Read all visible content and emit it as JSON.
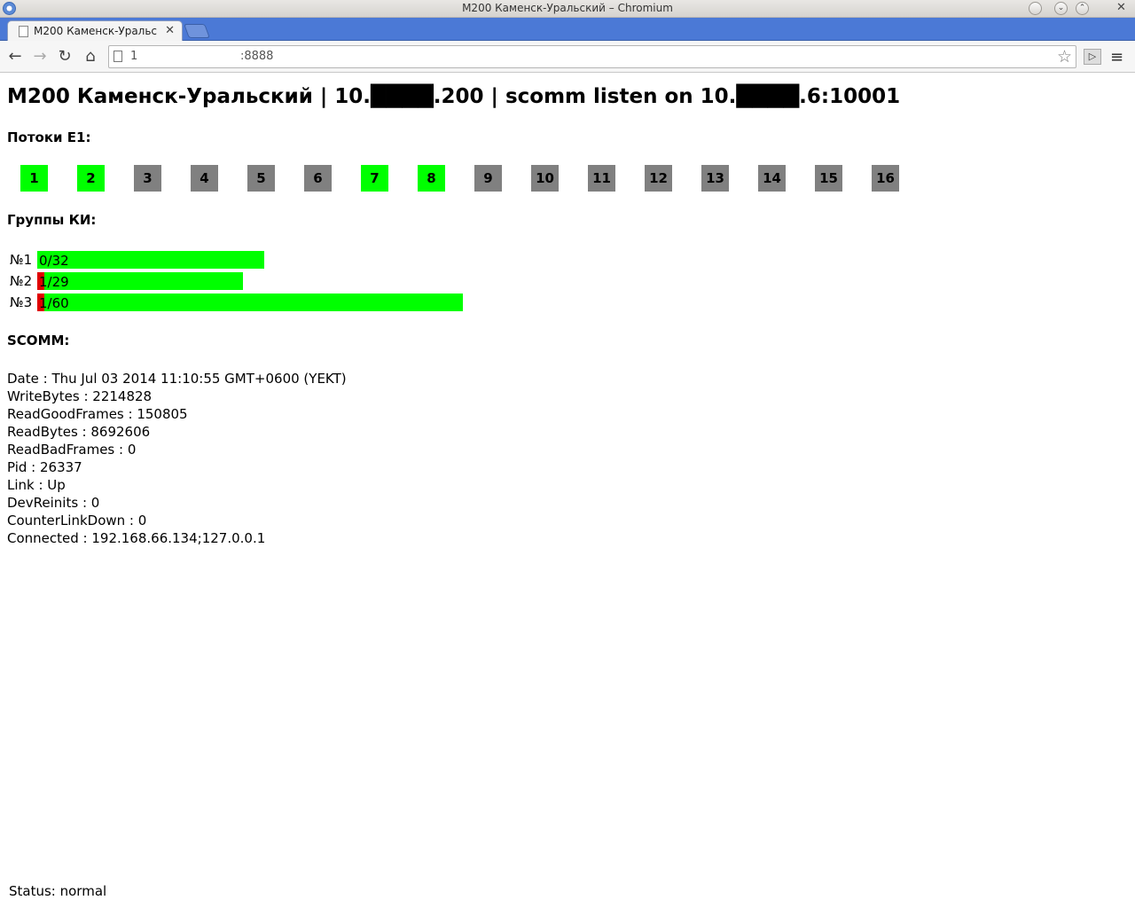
{
  "window": {
    "title": "M200 Каменск-Уральский – Chromium"
  },
  "tab": {
    "label": "M200 Каменск-Уральский"
  },
  "toolbar": {
    "url": "1                            :8888"
  },
  "page": {
    "heading": "M200 Каменск-Уральский | 10.████.200 | scomm listen on 10.████.6:10001",
    "e1_label": "Потоки E1:",
    "streams": [
      {
        "n": "1",
        "color": "#00ff00"
      },
      {
        "n": "2",
        "color": "#00ff00"
      },
      {
        "n": "3",
        "color": "#808080"
      },
      {
        "n": "4",
        "color": "#808080"
      },
      {
        "n": "5",
        "color": "#808080"
      },
      {
        "n": "6",
        "color": "#808080"
      },
      {
        "n": "7",
        "color": "#00ff00"
      },
      {
        "n": "8",
        "color": "#00ff00"
      },
      {
        "n": "9",
        "color": "#808080"
      },
      {
        "n": "10",
        "color": "#808080"
      },
      {
        "n": "11",
        "color": "#808080"
      },
      {
        "n": "12",
        "color": "#808080"
      },
      {
        "n": "13",
        "color": "#808080"
      },
      {
        "n": "14",
        "color": "#808080"
      },
      {
        "n": "15",
        "color": "#808080"
      },
      {
        "n": "16",
        "color": "#808080"
      }
    ],
    "groups_label": "Группы КИ:",
    "groups": [
      {
        "num": "№1",
        "text": "0/32",
        "errors": 0,
        "total": 32
      },
      {
        "num": "№2",
        "text": "1/29",
        "errors": 1,
        "total": 29
      },
      {
        "num": "№3",
        "text": "1/60",
        "errors": 1,
        "total": 60
      }
    ],
    "scomm_label": "SCOMM:",
    "stats": [
      "Date : Thu Jul 03 2014 11:10:55 GMT+0600 (YEKT)",
      "WriteBytes : 2214828",
      "ReadGoodFrames : 150805",
      "ReadBytes : 8692606",
      "ReadBadFrames : 0",
      "Pid : 26337",
      "Link : Up",
      "DevReinits : 0",
      "CounterLinkDown : 0",
      "Connected : 192.168.66.134;127.0.0.1"
    ],
    "status": "Status: normal"
  }
}
